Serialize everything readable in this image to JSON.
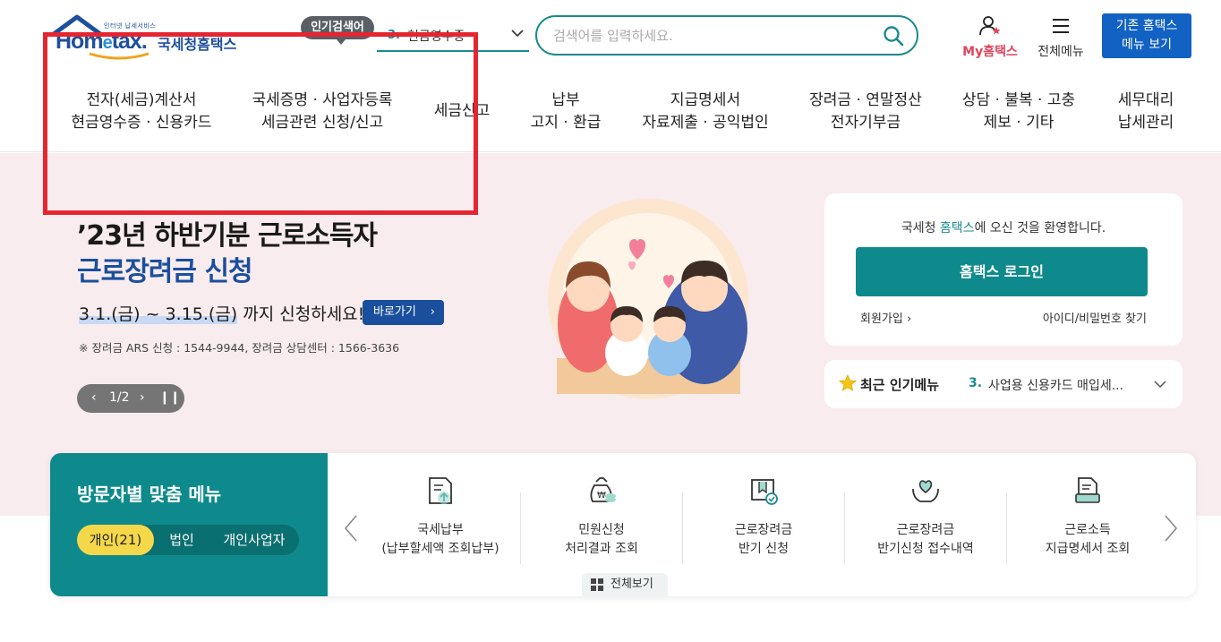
{
  "brand": {
    "tagline": "인터넷 납세서비스",
    "name_en_prefix": "Hom",
    "name_en_e": "e",
    "name_en_suffix": "tax.",
    "name_kr": "국세청홈택스"
  },
  "popular_search": {
    "badge": "인기검색어",
    "rank": "3.",
    "term": "현금영수증"
  },
  "search": {
    "placeholder": "검색어를 입력하세요."
  },
  "header_links": {
    "my": "My홈택스",
    "all_menu": "전체메뉴",
    "classic_line1": "기존 홈택스",
    "classic_line2": "메뉴 보기"
  },
  "gnb": [
    {
      "line1": "전자(세금)계산서",
      "line2": "현금영수증 · 신용카드"
    },
    {
      "line1": "국세증명 · 사업자등록",
      "line2": "세금관련 신청/신고"
    },
    {
      "line1": "세금신고",
      "line2": ""
    },
    {
      "line1": "납부",
      "line2": "고지 · 환급"
    },
    {
      "line1": "지급명세서",
      "line2": "자료제출 · 공익법인"
    },
    {
      "line1": "장려금 · 연말정산",
      "line2": "전자기부금"
    },
    {
      "line1": "상담 · 불복 · 고충",
      "line2": "제보 · 기타"
    },
    {
      "line1": "세무대리",
      "line2": "납세관리"
    }
  ],
  "hero": {
    "title_line1": "’23년 하반기분 근로소득자",
    "title_line2": "근로장려금 신청",
    "date_range": "3.1.(금) ~ 3.15.(금)",
    "date_suffix": " 까지 신청하세요!",
    "go_button": "바로가기",
    "note": "※ 장려금 ARS 신청 : 1544-9944, 장려금 상담센터 : 1566-3636",
    "pager": "1/2"
  },
  "login": {
    "welcome_prefix": "국세청 ",
    "welcome_brand": "홈택스",
    "welcome_suffix": "에 오신 것을 환영합니다.",
    "login_button": "홈택스 로그인",
    "join": "회원가입",
    "find": "아이디/비밀번호 찾기"
  },
  "recent_menu": {
    "title": "최근 인기메뉴",
    "rank": "3.",
    "term": "사업용 신용카드 매입세..."
  },
  "visitor_menu": {
    "title": "방문자별 맞춤 메뉴",
    "tabs": [
      "개인(21)",
      "법인",
      "개인사업자"
    ],
    "active_tab": "개인(21)",
    "items": [
      {
        "line1": "국세납부",
        "line2": "(납부할세액 조회납부)",
        "icon": "tax-payment-icon"
      },
      {
        "line1": "민원신청",
        "line2": "처리결과 조회",
        "icon": "money-bag-icon"
      },
      {
        "line1": "근로장려금",
        "line2": "반기 신청",
        "icon": "certificate-icon"
      },
      {
        "line1": "근로장려금",
        "line2": "반기신청 접수내역",
        "icon": "heart-hands-icon"
      },
      {
        "line1": "근로소득",
        "line2": "지급명세서 조회",
        "icon": "document-stack-icon"
      }
    ],
    "view_all": "전체보기"
  },
  "colors": {
    "teal": "#0f8a8c",
    "navy": "#1a4f9d",
    "hero_bg": "#f9ecee",
    "highlight_red": "#e52530",
    "tab_active": "#f5d84a"
  }
}
